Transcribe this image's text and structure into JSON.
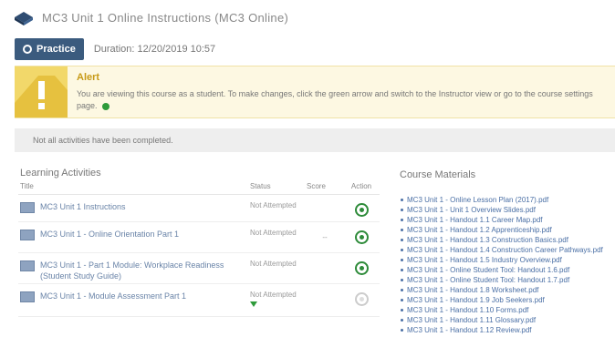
{
  "header": {
    "title": "MC3 Unit 1 Online Instructions (MC3 Online)"
  },
  "toolbar": {
    "practice_label": "Practice",
    "duration": "Duration: 12/20/2019 10:57"
  },
  "alert": {
    "title": "Alert",
    "text": "You are viewing this course as a student. To make changes, click the green arrow and switch to the Instructor view or go to the course settings page."
  },
  "notice": {
    "text": "Not all activities have been completed."
  },
  "activities": {
    "heading": "Learning Activities",
    "columns": {
      "title": "Title",
      "status": "Status",
      "score": "Score",
      "action": "Action"
    },
    "rows": [
      {
        "title": "MC3 Unit 1 Instructions",
        "status": "Not Attempted",
        "score": "",
        "action": "start"
      },
      {
        "title": "MC3 Unit 1 - Online Orientation Part 1",
        "status": "Not Attempted",
        "score": "--",
        "action": "start"
      },
      {
        "title": "MC3 Unit 1 - Part 1 Module: Workplace Readiness (Student Study Guide)",
        "status": "Not Attempted",
        "score": "",
        "action": "start"
      },
      {
        "title": "MC3 Unit 1 - Module Assessment Part 1",
        "status": "Not Attempted",
        "score": "",
        "action": "locked"
      }
    ]
  },
  "materials": {
    "heading": "Course Materials",
    "items": [
      "MC3 Unit 1 - Online Lesson Plan (2017).pdf",
      "MC3 Unit 1 - Unit 1 Overview Slides.pdf",
      "MC3 Unit 1 - Handout 1.1 Career Map.pdf",
      "MC3 Unit 1 - Handout 1.2 Apprenticeship.pdf",
      "MC3 Unit 1 - Handout 1.3 Construction Basics.pdf",
      "MC3 Unit 1 - Handout 1.4 Construction Career Pathways.pdf",
      "MC3 Unit 1 - Handout 1.5 Industry Overview.pdf",
      "MC3 Unit 1 - Online Student Tool: Handout 1.6.pdf",
      "MC3 Unit 1 - Online Student Tool: Handout 1.7.pdf",
      "MC3 Unit 1 - Handout 1.8 Worksheet.pdf",
      "MC3 Unit 1 - Handout 1.9 Job Seekers.pdf",
      "MC3 Unit 1 - Handout 1.10 Forms.pdf",
      "MC3 Unit 1 - Handout 1.11 Glossary.pdf",
      "MC3 Unit 1 - Handout 1.12 Review.pdf"
    ]
  },
  "colors": {
    "accent": "#3b5b7e",
    "alert": "#f2d86a",
    "link": "#4a6fa5",
    "success": "#2e8b3a"
  }
}
